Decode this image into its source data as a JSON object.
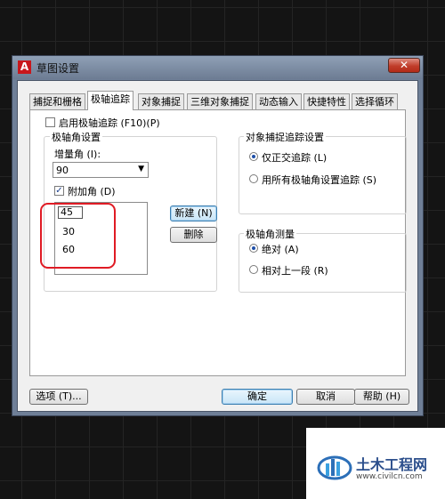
{
  "window": {
    "title": "草图设置",
    "app_icon": "A",
    "close_glyph": "✕"
  },
  "tabs": [
    {
      "label": "捕捉和栅格",
      "active": false
    },
    {
      "label": "极轴追踪",
      "active": true
    },
    {
      "label": "对象捕捉",
      "active": false
    },
    {
      "label": "三维对象捕捉",
      "active": false
    },
    {
      "label": "动态输入",
      "active": false
    },
    {
      "label": "快捷特性",
      "active": false
    },
    {
      "label": "选择循环",
      "active": false
    }
  ],
  "polar": {
    "enable_label": "启用极轴追踪 (F10)(P)",
    "enable_checked": false,
    "angle_settings_title": "极轴角设置",
    "increment_label": "增量角 (I):",
    "increment_value": "90",
    "additional_label": "附加角 (D)",
    "additional_checked": true,
    "additional_angles": [
      "45",
      "30",
      "60"
    ],
    "new_button": "新建 (N)",
    "delete_button": "删除"
  },
  "object_snap_tracking": {
    "title": "对象捕捉追踪设置",
    "options": [
      {
        "label": "仅正交追踪 (L)",
        "selected": true
      },
      {
        "label": "用所有极轴角设置追踪 (S)",
        "selected": false
      }
    ]
  },
  "polar_measurement": {
    "title": "极轴角测量",
    "options": [
      {
        "label": "绝对 (A)",
        "selected": true
      },
      {
        "label": "相对上一段 (R)",
        "selected": false
      }
    ]
  },
  "footer": {
    "options_button": "选项 (T)...",
    "ok_button": "确定",
    "cancel_button": "取消",
    "help_button": "帮助 (H)"
  },
  "annotation": {
    "highlight_color": "#e01b24"
  },
  "watermark": {
    "logo_text": "土木工程网",
    "url": "www.civilcn.com"
  }
}
